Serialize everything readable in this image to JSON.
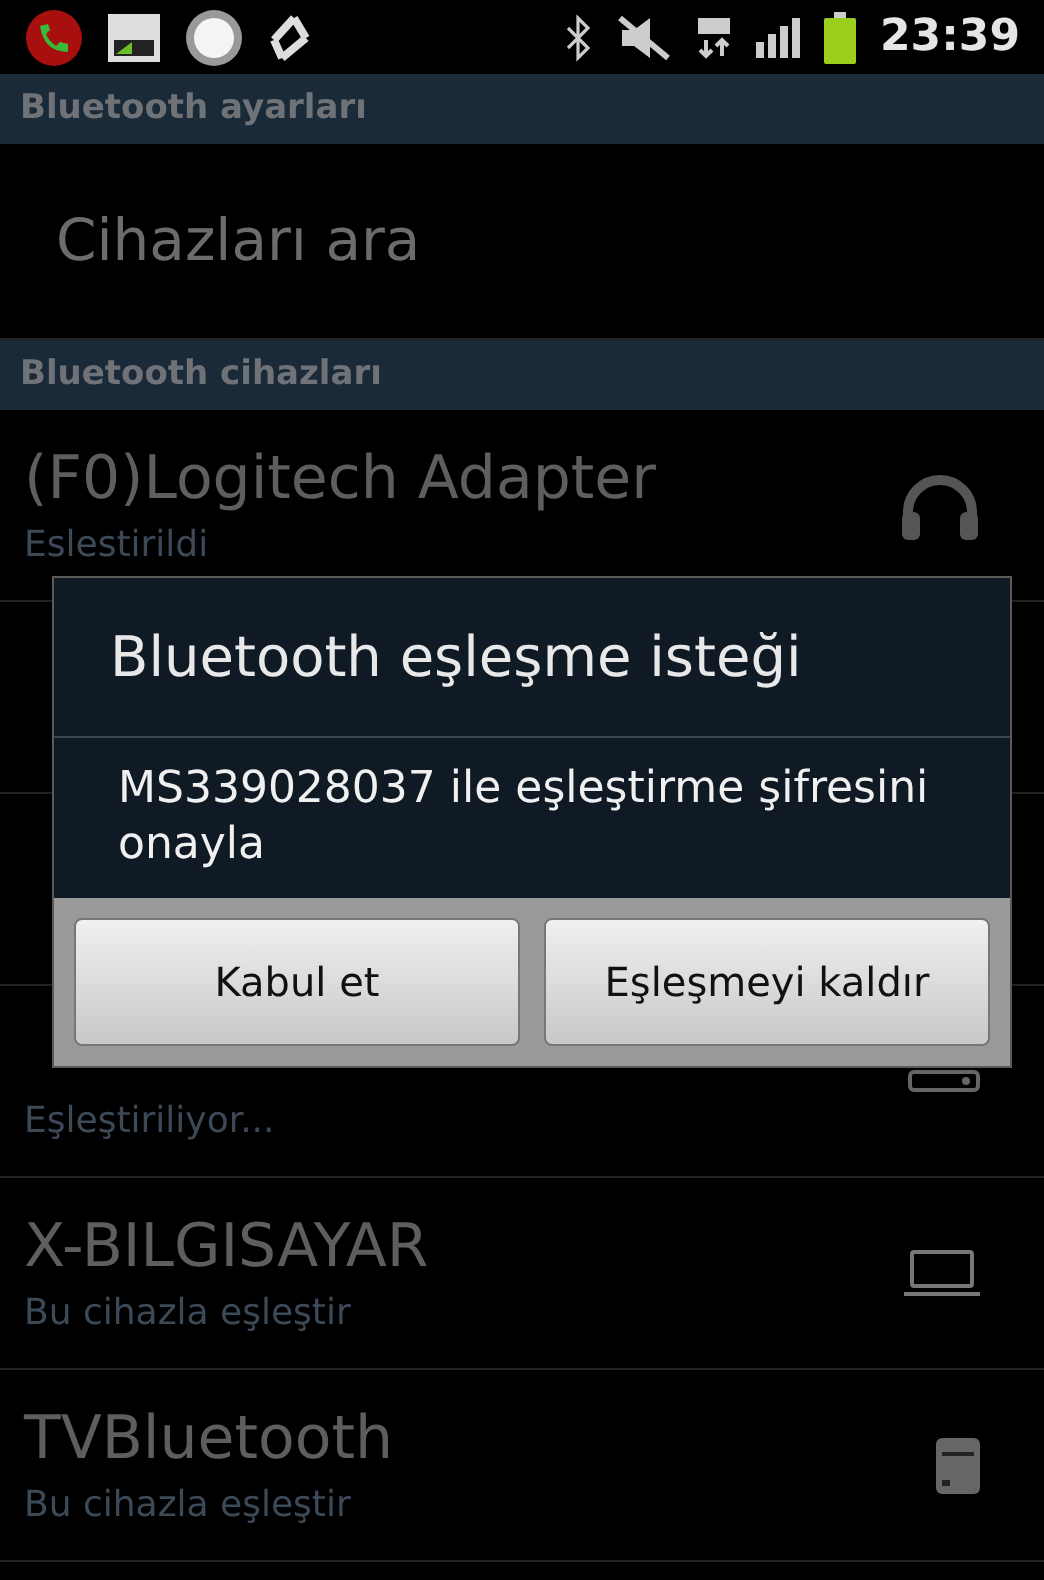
{
  "status_bar": {
    "time": "23:39"
  },
  "sections": [
    {
      "header": "Bluetooth ayarları",
      "items": [
        {
          "kind": "action",
          "title": "Cihazları ara"
        }
      ]
    },
    {
      "header": "Bluetooth cihazları",
      "items": [
        {
          "kind": "headphones",
          "title": "(F0)Logitech Adapter",
          "subtitle": "Eslestirildi"
        },
        {
          "kind": "hidden"
        },
        {
          "kind": "hidden"
        },
        {
          "kind": "keyboard",
          "subtitle": "Eşleştiriliyor..."
        },
        {
          "kind": "laptop",
          "title": "X-BILGISAYAR",
          "subtitle": "Bu cihazla eşleştir"
        },
        {
          "kind": "phone",
          "title": "TVBluetooth",
          "subtitle": "Bu cihazla eşleştir"
        }
      ]
    }
  ],
  "dialog": {
    "title": "Bluetooth eşleşme isteği",
    "message": "MS339028037 ile eşleştirme şifresini onayla",
    "buttons": [
      "Kabul et",
      "Eşleşmeyi kaldır"
    ]
  }
}
